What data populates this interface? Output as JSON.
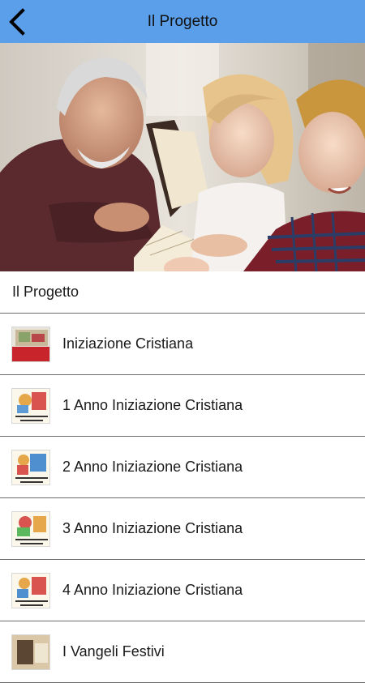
{
  "header": {
    "title": "Il Progetto",
    "back_icon": "chevron-left-icon",
    "background": "#5b9ee9"
  },
  "hero": {
    "image": "grandfather-reading-book-with-children-photo"
  },
  "section": {
    "title": "Il Progetto"
  },
  "list": {
    "items": [
      {
        "label": "Iniziazione Cristiana",
        "thumb_text": "INIZIAZIONE CRISTIANA: IL PROGETTO",
        "thumb_icon": "project-cover-thumbnail"
      },
      {
        "label": "1 Anno Iniziazione Cristiana",
        "thumb_text": "1 ANNO INIZIAZIONE CRISTIANA",
        "thumb_icon": "year-cover-thumbnail"
      },
      {
        "label": "2 Anno Iniziazione Cristiana",
        "thumb_text": "2 ANNO INIZIAZIONE CRISTIANA",
        "thumb_icon": "year-cover-thumbnail"
      },
      {
        "label": "3 Anno Iniziazione Cristiana",
        "thumb_text": "3 ANNO INIZIAZIONE CRISTIANA",
        "thumb_icon": "year-cover-thumbnail"
      },
      {
        "label": "4 Anno Iniziazione Cristiana",
        "thumb_text": "4 ANNO INIZIAZIONE CRISTIANA",
        "thumb_icon": "year-cover-thumbnail"
      },
      {
        "label": "I Vangeli Festivi",
        "thumb_text": "",
        "thumb_icon": "gospel-thumbnail"
      }
    ]
  }
}
